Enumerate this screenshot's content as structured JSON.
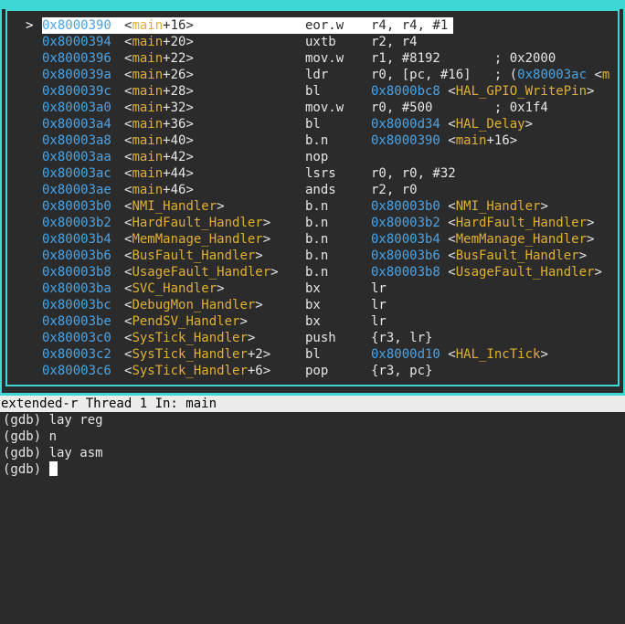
{
  "asm_window": {
    "current_marker": ">",
    "rows": [
      {
        "addr": "0x8000390",
        "fn": "main",
        "off": "+16",
        "mnem": "eor.w",
        "ops": "r4, r4, #1",
        "current": true
      },
      {
        "addr": "0x8000394",
        "fn": "main",
        "off": "+20",
        "mnem": "uxtb",
        "ops": "r2, r4"
      },
      {
        "addr": "0x8000396",
        "fn": "main",
        "off": "+22",
        "mnem": "mov.w",
        "ops": "r1, #8192       ; 0x2000"
      },
      {
        "addr": "0x800039a",
        "fn": "main",
        "off": "+26",
        "mnem": "ldr",
        "ops_pre": "r0, [pc, #16]   ; (",
        "ops_addr": "0x80003ac",
        "ops_post": " <",
        "ops_fn": "m"
      },
      {
        "addr": "0x800039c",
        "fn": "main",
        "off": "+28",
        "mnem": "bl",
        "target": "0x8000bc8",
        "target_fn": "HAL_GPIO_WritePin",
        "target_close": ">"
      },
      {
        "addr": "0x80003a0",
        "fn": "main",
        "off": "+32",
        "mnem": "mov.w",
        "ops": "r0, #500        ; 0x1f4"
      },
      {
        "addr": "0x80003a4",
        "fn": "main",
        "off": "+36",
        "mnem": "bl",
        "target": "0x8000d34",
        "target_fn": "HAL_Delay",
        "target_close": ">"
      },
      {
        "addr": "0x80003a8",
        "fn": "main",
        "off": "+40",
        "mnem": "b.n",
        "target": "0x8000390",
        "target_fn": "main",
        "target_off": "+16",
        "target_close": ">"
      },
      {
        "addr": "0x80003aa",
        "fn": "main",
        "off": "+42",
        "mnem": "nop",
        "ops": ""
      },
      {
        "addr": "0x80003ac",
        "fn": "main",
        "off": "+44",
        "mnem": "lsrs",
        "ops": "r0, r0, #32"
      },
      {
        "addr": "0x80003ae",
        "fn": "main",
        "off": "+46",
        "mnem": "ands",
        "ops": "r2, r0"
      },
      {
        "addr": "0x80003b0",
        "fn": "NMI_Handler",
        "off": "",
        "mnem": "b.n",
        "target": "0x80003b0",
        "target_fn": "NMI_Handler",
        "target_close": ">"
      },
      {
        "addr": "0x80003b2",
        "fn": "HardFault_Handler",
        "off": "",
        "mnem": "b.n",
        "target": "0x80003b2",
        "target_fn": "HardFault_Handler",
        "target_close": ">"
      },
      {
        "addr": "0x80003b4",
        "fn": "MemManage_Handler",
        "off": "",
        "mnem": "b.n",
        "target": "0x80003b4",
        "target_fn": "MemManage_Handler",
        "target_close": ">"
      },
      {
        "addr": "0x80003b6",
        "fn": "BusFault_Handler",
        "off": "",
        "mnem": "b.n",
        "target": "0x80003b6",
        "target_fn": "BusFault_Handler",
        "target_close": ">"
      },
      {
        "addr": "0x80003b8",
        "fn": "UsageFault_Handler",
        "off": "",
        "mnem": "b.n",
        "target": "0x80003b8",
        "target_fn": "UsageFault_Handler",
        "target_close": ">"
      },
      {
        "addr": "0x80003ba",
        "fn": "SVC_Handler",
        "off": "",
        "mnem": "bx",
        "ops": "lr"
      },
      {
        "addr": "0x80003bc",
        "fn": "DebugMon_Handler",
        "off": "",
        "mnem": "bx",
        "ops": "lr"
      },
      {
        "addr": "0x80003be",
        "fn": "PendSV_Handler",
        "off": "",
        "mnem": "bx",
        "ops": "lr"
      },
      {
        "addr": "0x80003c0",
        "fn": "SysTick_Handler",
        "off": "",
        "mnem": "push",
        "ops": "{r3, lr}"
      },
      {
        "addr": "0x80003c2",
        "fn": "SysTick_Handler",
        "off": "+2",
        "mnem": "bl",
        "target": "0x8000d10",
        "target_fn": "HAL_IncTick",
        "target_close": ">"
      },
      {
        "addr": "0x80003c6",
        "fn": "SysTick_Handler",
        "off": "+6",
        "mnem": "pop",
        "ops": "{r3, pc}"
      }
    ]
  },
  "status_bar": {
    "text": "extended-r Thread 1 In: main"
  },
  "console": {
    "lines": [
      "(gdb) lay reg",
      "(gdb) n",
      "(gdb) lay asm"
    ],
    "prompt": "(gdb) "
  },
  "colors": {
    "frame": "#3fd6d6",
    "address": "#4aa3e6",
    "function": "#e0b030",
    "background": "#2b2b2b"
  }
}
